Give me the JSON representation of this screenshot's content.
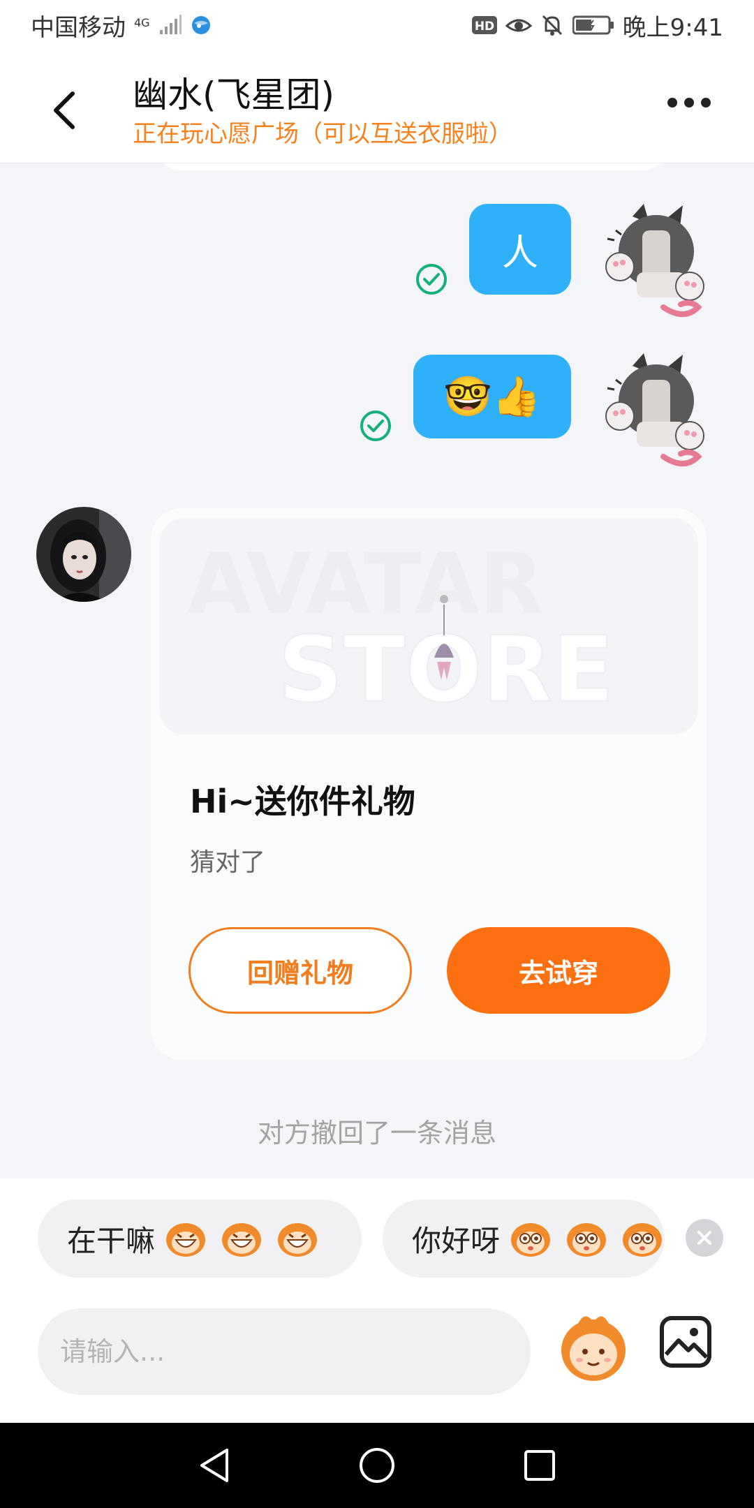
{
  "status_bar": {
    "carrier": "中国移动",
    "network": "4G",
    "time": "晚上9:41",
    "hd_badge": "HD"
  },
  "header": {
    "title": "幽水(飞星团)",
    "subtitle": "正在玩心愿广场（可以互送衣服啦）",
    "icons": {
      "back": "chevron-left-icon",
      "more": "more-dots-icon"
    }
  },
  "messages": {
    "sent_1": {
      "text": "人",
      "status_icon": "check-circle-icon"
    },
    "sent_2": {
      "text": "🤓👍",
      "status_icon": "check-circle-icon"
    }
  },
  "gift_card": {
    "watermark_line1": "AVATAR",
    "watermark_line2": "STORE",
    "title": "Hi~送你件礼物",
    "description": "猜对了",
    "return_button": "回赠礼物",
    "try_button": "去试穿"
  },
  "system_notice": "对方撤回了一条消息",
  "quick_replies": [
    {
      "text": "在干嘛",
      "emoji_icon": "monkey-laugh-icon"
    },
    {
      "text": "你好呀",
      "emoji_icon": "monkey-wow-icon"
    }
  ],
  "input": {
    "placeholder": "请输入..."
  },
  "colors": {
    "accent_orange": "#fd7012",
    "subtitle_orange": "#f5821f",
    "bubble_blue": "#2fb1f9",
    "check_green": "#13b07a"
  }
}
